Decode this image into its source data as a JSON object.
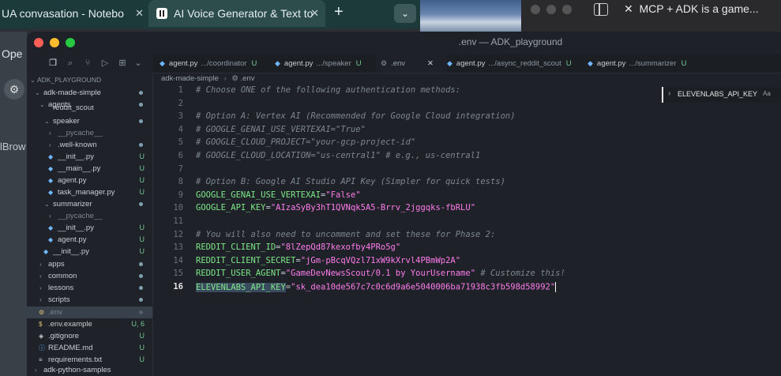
{
  "browser": {
    "tabs": [
      {
        "title": "UA convasation - Notebo"
      },
      {
        "title": "AI Voice Generator & Text to"
      }
    ],
    "new_tab_symbol": "+",
    "second_window_title": "MCP + ADK is a game..."
  },
  "background_app": {
    "peek_label_1": "Ope",
    "peek_label_2": "lBrow"
  },
  "window": {
    "title": ".env — ADK_playground"
  },
  "explorer": {
    "root": "ADK_PLAYGROUND",
    "items": [
      {
        "label": "adk-made-simple",
        "kind": "folder",
        "open": true
      },
      {
        "label": "agents",
        "kind": "folder",
        "open": true
      },
      {
        "label": "reddit_scout",
        "kind": "folder"
      },
      {
        "label": "speaker",
        "kind": "folder",
        "open": true
      },
      {
        "label": "__pycache__",
        "kind": "folder"
      },
      {
        "label": ".well-known",
        "kind": "folder"
      },
      {
        "label": "__init__.py",
        "kind": "file",
        "badge": "U"
      },
      {
        "label": "__main__.py",
        "kind": "file",
        "badge": "U"
      },
      {
        "label": "agent.py",
        "kind": "file",
        "badge": "U"
      },
      {
        "label": "task_manager.py",
        "kind": "file",
        "badge": "U"
      },
      {
        "label": "summarizer",
        "kind": "folder",
        "open": true
      },
      {
        "label": "__pycache__",
        "kind": "folder"
      },
      {
        "label": "__init__.py",
        "kind": "file",
        "badge": "U"
      },
      {
        "label": "agent.py",
        "kind": "file",
        "badge": "U"
      },
      {
        "label": "__init__.py",
        "kind": "file",
        "badge": "U"
      },
      {
        "label": "apps",
        "kind": "folder"
      },
      {
        "label": "common",
        "kind": "folder"
      },
      {
        "label": "lessons",
        "kind": "folder"
      },
      {
        "label": "scripts",
        "kind": "folder"
      },
      {
        "label": ".env",
        "kind": "file",
        "selected": true
      },
      {
        "label": ".env.example",
        "kind": "file",
        "badge": "U, 6"
      },
      {
        "label": ".gitignore",
        "kind": "file",
        "badge": "U"
      },
      {
        "label": "README.md",
        "kind": "file",
        "badge": "U"
      },
      {
        "label": "requirements.txt",
        "kind": "file",
        "badge": "U"
      },
      {
        "label": "adk-python-samples",
        "kind": "folder"
      }
    ]
  },
  "tabs": [
    {
      "name": "agent.py",
      "dir": ".../coordinator",
      "badge": "U"
    },
    {
      "name": "agent.py",
      "dir": ".../speaker",
      "badge": "U"
    },
    {
      "name": ".env",
      "dir": "",
      "badge": ""
    },
    {
      "name": "agent.py",
      "dir": ".../async_reddit_scout",
      "badge": "U"
    },
    {
      "name": "agent.py",
      "dir": ".../summarizer",
      "badge": "U"
    }
  ],
  "breadcrumb": {
    "folder": "adk-made-simple",
    "file": ".env"
  },
  "find": {
    "value": "ELEVENLABS_API_KEY",
    "option": "Aa"
  },
  "editor": {
    "lines": [
      {
        "n": "1",
        "comment": "# Choose ONE of the following authentication methods:"
      },
      {
        "n": "2"
      },
      {
        "n": "3",
        "comment": "# Option A: Vertex AI (Recommended for Google Cloud integration)"
      },
      {
        "n": "4",
        "comment": "# GOOGLE_GENAI_USE_VERTEXAI=\"True\""
      },
      {
        "n": "5",
        "comment": "# GOOGLE_CLOUD_PROJECT=\"your-gcp-project-id\""
      },
      {
        "n": "6",
        "comment": "# GOOGLE_CLOUD_LOCATION=\"us-central1\" # e.g., us-central1"
      },
      {
        "n": "7"
      },
      {
        "n": "8",
        "comment": "# Option B: Google AI Studio API Key (Simpler for quick tests)"
      },
      {
        "n": "9",
        "key": "GOOGLE_GENAI_USE_VERTEXAI",
        "value": "\"False\""
      },
      {
        "n": "10",
        "key": "GOOGLE_API_KEY",
        "value": "\"AIzaSyBy3hT1QVNqk5A5-Brrv_2jggqks-fbRLU\""
      },
      {
        "n": "11"
      },
      {
        "n": "12",
        "comment": "# You will also need to uncomment and set these for Phase 2:"
      },
      {
        "n": "13",
        "key": "REDDIT_CLIENT_ID",
        "value": "\"8lZepQd87kexofby4PRo5g\""
      },
      {
        "n": "14",
        "key": "REDDIT_CLIENT_SECRET",
        "value": "\"jGm-pBcqVQzl71xW9kXrvl4PBmWp2A\""
      },
      {
        "n": "15",
        "key": "REDDIT_USER_AGENT",
        "value": "\"GameDevNewsScout/0.1 by YourUsername\"",
        "trailing": " # Customize this!"
      },
      {
        "n": "16",
        "key": "ELEVENLABS_API_KEY",
        "value": "\"sk_dea10de567c7c0c6d9a6e5040006ba71938c3fb598d58992\"",
        "current": true
      }
    ]
  },
  "colors": {
    "comment": "#7d8590",
    "key": "#7ee787",
    "string": "#ff7bea",
    "added": "#73c991"
  }
}
